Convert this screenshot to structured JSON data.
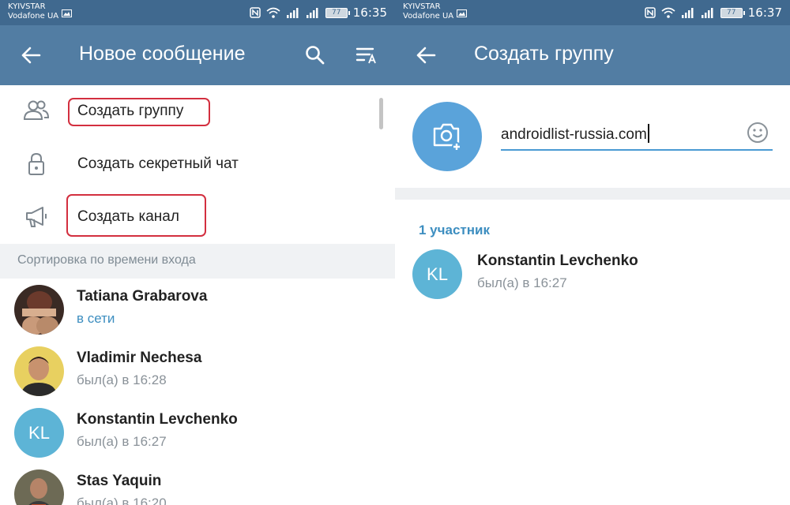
{
  "left": {
    "status": {
      "carrier1": "KYIVSTAR",
      "carrier2": "Vodafone UA",
      "battery": "77",
      "time": "16:35"
    },
    "appbar": {
      "title": "Новое сообщение"
    },
    "actions": [
      {
        "label": "Создать группу",
        "icon": "people-icon"
      },
      {
        "label": "Создать секретный чат",
        "icon": "lock-icon"
      },
      {
        "label": "Создать канал",
        "icon": "megaphone-icon"
      }
    ],
    "section_header": "Сортировка по времени входа",
    "contacts": [
      {
        "name": "Tatiana Grabarova",
        "status": "в сети",
        "online": true
      },
      {
        "name": "Vladimir Nechesa",
        "status": "был(а) в 16:28",
        "online": false
      },
      {
        "name": "Konstantin Levchenko",
        "status": "был(а) в 16:27",
        "online": false,
        "initials": "KL"
      },
      {
        "name": "Stas Yaquin",
        "status": "был(а) в 16:20",
        "online": false
      }
    ]
  },
  "right": {
    "status": {
      "carrier1": "KYIVSTAR",
      "carrier2": "Vodafone UA",
      "battery": "77",
      "time": "16:37"
    },
    "appbar": {
      "title": "Создать группу"
    },
    "group_name": "androidlist-russia.com",
    "members_count": "1 участник",
    "member": {
      "name": "Konstantin Levchenko",
      "status": "был(а) в 16:27",
      "initials": "KL"
    }
  },
  "colors": {
    "statusbar": "#40698f",
    "appbar": "#527da3",
    "accent": "#4a9ad3",
    "avatar_kl": "#5db4d6",
    "highlight": "#d32f3f"
  }
}
